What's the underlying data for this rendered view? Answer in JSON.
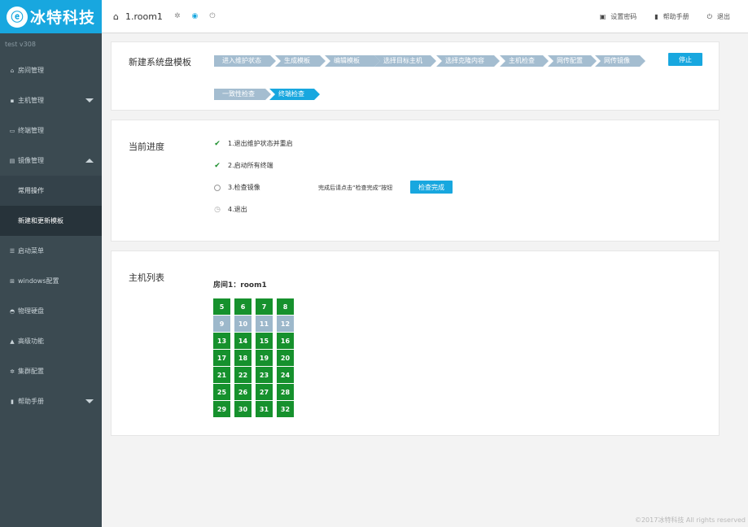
{
  "brand": {
    "logo_glyph": "ⓔ",
    "name": "冰特科技",
    "color": "#18a7df"
  },
  "sidebar": {
    "version": "test  v308",
    "items": [
      {
        "icon": "home-icon",
        "glyph": "⌂",
        "label": "房间管理"
      },
      {
        "icon": "server-icon",
        "glyph": "▪",
        "label": "主机管理"
      },
      {
        "icon": "monitor-icon",
        "glyph": "▭",
        "label": "终端管理"
      },
      {
        "icon": "image-icon",
        "glyph": "▤",
        "label": "镜像管理"
      },
      {
        "icon": "list-icon",
        "glyph": "☰",
        "label": "启动菜单"
      },
      {
        "icon": "windows-icon",
        "glyph": "⊞",
        "label": "windows配置"
      },
      {
        "icon": "disk-icon",
        "glyph": "◓",
        "label": "物理硬盘"
      },
      {
        "icon": "warning-icon",
        "glyph": "▲",
        "label": "高级功能"
      },
      {
        "icon": "gear-icon",
        "glyph": "✲",
        "label": "集群配置"
      },
      {
        "icon": "book-icon",
        "glyph": "▮",
        "label": "帮助手册"
      }
    ],
    "sub_items": [
      {
        "label": "常用操作"
      },
      {
        "label": "新建和更新模板"
      }
    ]
  },
  "topbar": {
    "room": "1.room1",
    "links": [
      {
        "icon": "lock-icon",
        "glyph": "🔒",
        "label": "设置密码"
      },
      {
        "icon": "manual-icon",
        "glyph": "▮",
        "label": "帮助手册"
      },
      {
        "icon": "power-icon",
        "glyph": "⏻",
        "label": "退出"
      }
    ]
  },
  "template_panel": {
    "title": "新建系统盘模板",
    "steps": [
      "进入维护状态",
      "生成模板",
      "编辑模板",
      "选择目标主机",
      "选择克隆内容",
      "主机检查",
      "网传配置",
      "网传镜像",
      "一致性检查",
      "终端检查"
    ],
    "stop_label": "停止"
  },
  "progress_panel": {
    "title": "当前进度",
    "items": [
      {
        "status": "done",
        "label": "1.退出维护状态并重启"
      },
      {
        "status": "done",
        "label": "2.启动所有终端"
      },
      {
        "status": "current",
        "label": "3.检查镜像"
      },
      {
        "status": "pending",
        "label": "4.退出"
      }
    ],
    "hint": "完成后请点击“检查完成”按钮",
    "check_done_label": "检查完成"
  },
  "host_panel": {
    "title": "主机列表",
    "room_label": "房间1：room1",
    "hosts": [
      {
        "n": "5",
        "on": true
      },
      {
        "n": "6",
        "on": true
      },
      {
        "n": "7",
        "on": true
      },
      {
        "n": "8",
        "on": true
      },
      {
        "n": "9",
        "on": false
      },
      {
        "n": "10",
        "on": false
      },
      {
        "n": "11",
        "on": false
      },
      {
        "n": "12",
        "on": false
      },
      {
        "n": "13",
        "on": true
      },
      {
        "n": "14",
        "on": true
      },
      {
        "n": "15",
        "on": true
      },
      {
        "n": "16",
        "on": true
      },
      {
        "n": "17",
        "on": true
      },
      {
        "n": "18",
        "on": true
      },
      {
        "n": "19",
        "on": true
      },
      {
        "n": "20",
        "on": true
      },
      {
        "n": "21",
        "on": true
      },
      {
        "n": "22",
        "on": true
      },
      {
        "n": "23",
        "on": true
      },
      {
        "n": "24",
        "on": true
      },
      {
        "n": "25",
        "on": true
      },
      {
        "n": "26",
        "on": true
      },
      {
        "n": "27",
        "on": true
      },
      {
        "n": "28",
        "on": true
      },
      {
        "n": "29",
        "on": true
      },
      {
        "n": "30",
        "on": true
      },
      {
        "n": "31",
        "on": true
      },
      {
        "n": "32",
        "on": true
      }
    ],
    "colors": {
      "online": "#16912d",
      "offline": "#9db8cb"
    }
  },
  "footer": "©2017冰特科技 All rights reserved"
}
